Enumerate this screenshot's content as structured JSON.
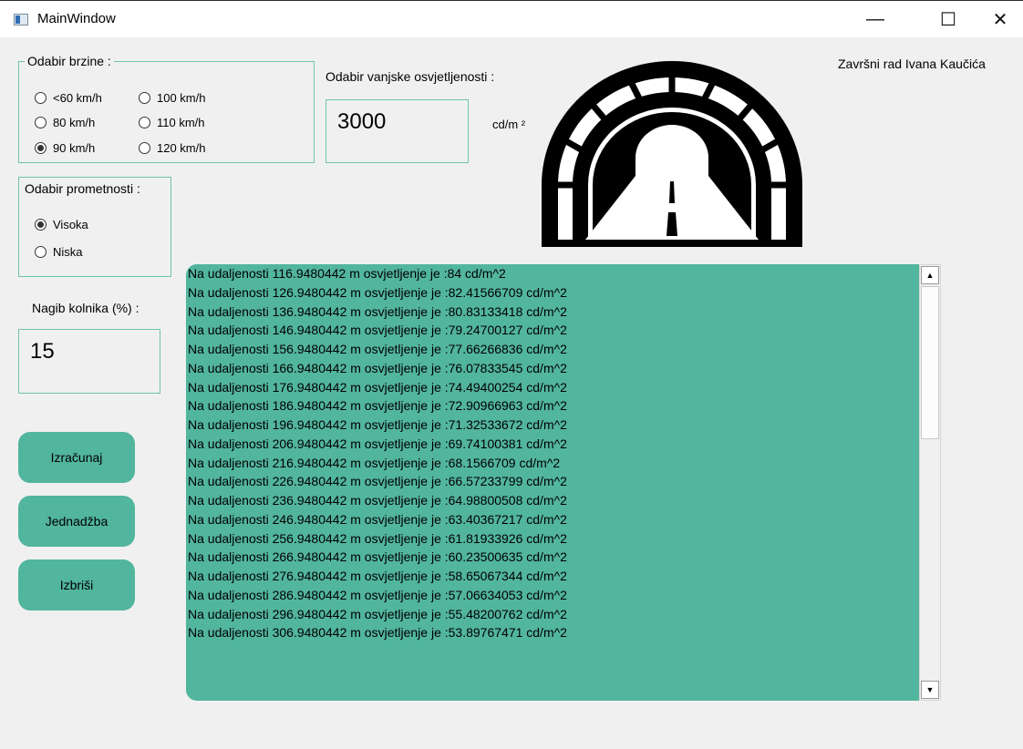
{
  "window": {
    "title": "MainWindow",
    "controls": {
      "minimize": "—",
      "maximize": "☐",
      "close": "✕"
    }
  },
  "speed_group": {
    "title": "Odabir brzine :",
    "options": [
      {
        "label": "<60 km/h",
        "selected": false
      },
      {
        "label": "80 km/h",
        "selected": false
      },
      {
        "label": "90 km/h",
        "selected": true
      },
      {
        "label": "100 km/h",
        "selected": false
      },
      {
        "label": "110 km/h",
        "selected": false
      },
      {
        "label": "120 km/h",
        "selected": false
      }
    ]
  },
  "traffic_group": {
    "title": "Odabir prometnosti :",
    "options": [
      {
        "label": "Visoka",
        "selected": true
      },
      {
        "label": "Niska",
        "selected": false
      }
    ]
  },
  "slope": {
    "label": "Nagib kolnika (%) :",
    "value": "15"
  },
  "lighting": {
    "label": "Odabir vanjske osvjetljenosti :",
    "value": "3000",
    "unit": "cd/m ²"
  },
  "author": "Završni rad Ivana Kaučića",
  "buttons": {
    "calculate": "Izračunaj",
    "equation": "Jednadžba",
    "delete": "Izbriši"
  },
  "results": [
    "Na udaljenosti 116.9480442 m osvjetljenje je :84 cd/m^2",
    "Na udaljenosti 126.9480442 m osvjetljenje je :82.41566709 cd/m^2",
    "Na udaljenosti 136.9480442 m osvjetljenje je :80.83133418 cd/m^2",
    "Na udaljenosti 146.9480442 m osvjetljenje je :79.24700127 cd/m^2",
    "Na udaljenosti 156.9480442 m osvjetljenje je :77.66266836 cd/m^2",
    "Na udaljenosti 166.9480442 m osvjetljenje je :76.07833545 cd/m^2",
    "Na udaljenosti 176.9480442 m osvjetljenje je :74.49400254 cd/m^2",
    "Na udaljenosti 186.9480442 m osvjetljenje je :72.90966963 cd/m^2",
    "Na udaljenosti 196.9480442 m osvjetljenje je :71.32533672 cd/m^2",
    "Na udaljenosti 206.9480442 m osvjetljenje je :69.74100381 cd/m^2",
    "Na udaljenosti 216.9480442 m osvjetljenje je :68.1566709 cd/m^2",
    "Na udaljenosti 226.9480442 m osvjetljenje je :66.57233799 cd/m^2",
    "Na udaljenosti 236.9480442 m osvjetljenje je :64.98800508 cd/m^2",
    "Na udaljenosti 246.9480442 m osvjetljenje je :63.40367217 cd/m^2",
    "Na udaljenosti 256.9480442 m osvjetljenje je :61.81933926 cd/m^2",
    "Na udaljenosti 266.9480442 m osvjetljenje je :60.23500635 cd/m^2",
    "Na udaljenosti 276.9480442 m osvjetljenje je :58.65067344 cd/m^2",
    "Na udaljenosti 286.9480442 m osvjetljenje je :57.06634053 cd/m^2",
    "Na udaljenosti 296.9480442 m osvjetljenje je :55.48200762 cd/m^2",
    "Na udaljenosti 306.9480442 m osvjetljenje je :53.89767471 cd/m^2"
  ],
  "scrollbar": {
    "up": "▲",
    "down": "▼"
  },
  "colors": {
    "accent": "#52b59e",
    "border": "#6fc4a6",
    "background": "#f0f0f0"
  },
  "icons": {
    "tunnel": "tunnel-icon"
  }
}
